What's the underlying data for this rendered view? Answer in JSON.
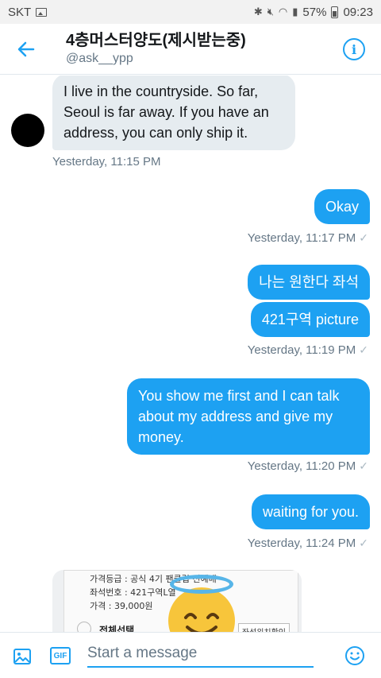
{
  "status": {
    "carrier": "SKT",
    "battery": "57%",
    "time": "09:23"
  },
  "header": {
    "title": "4층머스터양도(제시받는중)",
    "handle": "@ask__ypp"
  },
  "messages": [
    {
      "direction": "in",
      "text": "I live in the countryside. So far, Seoul is far away. If you have an address, you can only ship it.",
      "time": "Yesterday, 11:15 PM"
    },
    {
      "direction": "out",
      "text": "Okay",
      "time": "Yesterday, 11:17 PM"
    },
    {
      "direction": "out",
      "text": "나는 원한다 좌석"
    },
    {
      "direction": "out",
      "text": "421구역 picture",
      "time": "Yesterday, 11:19 PM"
    },
    {
      "direction": "out",
      "text": "You show me first and I can talk about my address and give my money.",
      "time": "Yesterday, 11:20 PM"
    },
    {
      "direction": "out",
      "text": "waiting for you.",
      "time": "Yesterday, 11:24 PM"
    }
  ],
  "attachment": {
    "line1": "가격등급 : 공식 4기 팬클럽 선예매",
    "line2": "좌석번호 : 421구역L열",
    "line3": "가격 : 39,000원",
    "select_all": "전체선택",
    "seat_button": "좌석위치확인"
  },
  "composer": {
    "placeholder": "Start a message",
    "gif_label": "GIF"
  },
  "colors": {
    "accent": "#1da1f2",
    "incoming_bubble": "#e6ecf0"
  },
  "icons": [
    "back-arrow-icon",
    "info-icon",
    "image-icon",
    "gif-icon",
    "emoji-icon"
  ]
}
